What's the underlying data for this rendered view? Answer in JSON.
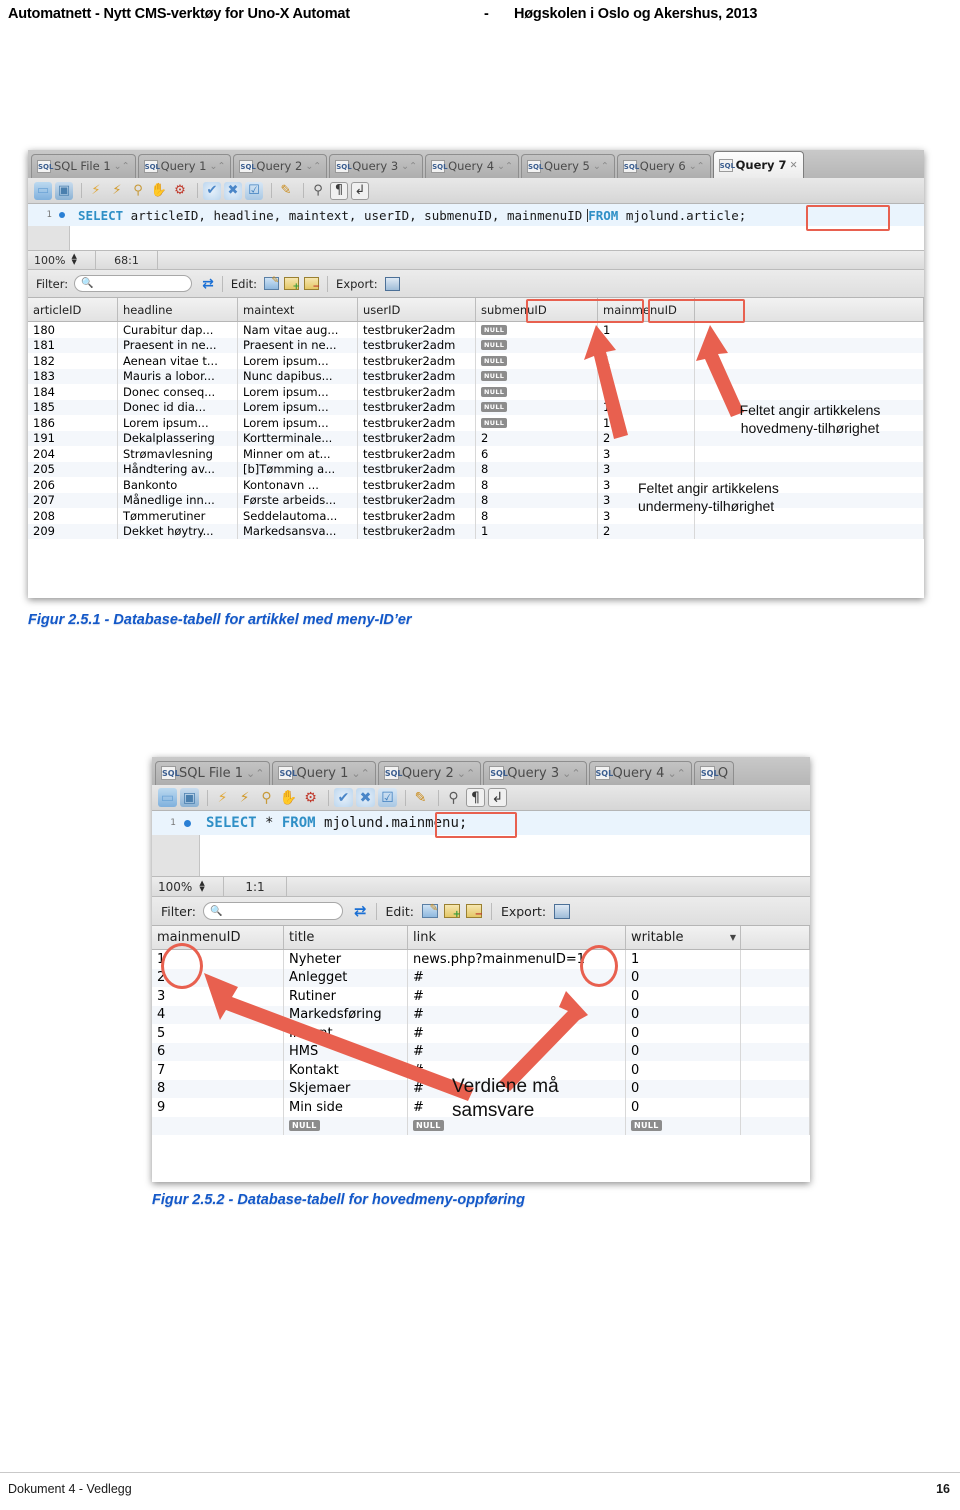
{
  "header": {
    "left": "Automatnett - Nytt CMS-verktøy for Uno-X Automat",
    "dash": "-",
    "right": "Høgskolen i Oslo og Akershus, 2013"
  },
  "footer": {
    "left": "Dokument 4 - Vedlegg",
    "page": "16"
  },
  "figure1": {
    "caption": "Figur 2.5.1 - Database-tabell for artikkel med meny-ID’er",
    "tabs": [
      {
        "label": "SQL File 1",
        "active": false,
        "close": "⌄⌃"
      },
      {
        "label": "Query 1",
        "active": false,
        "close": "⌄⌃"
      },
      {
        "label": "Query 2",
        "active": false,
        "close": "⌄⌃"
      },
      {
        "label": "Query 3",
        "active": false,
        "close": "⌄⌃"
      },
      {
        "label": "Query 4",
        "active": false,
        "close": "⌄⌃"
      },
      {
        "label": "Query 5",
        "active": false,
        "close": "⌄⌃"
      },
      {
        "label": "Query 6",
        "active": false,
        "close": "⌄⌃"
      },
      {
        "label": "Query 7",
        "active": true,
        "close": "✕"
      }
    ],
    "tab_icon_label": "SQL",
    "toolbar_icons": [
      "open-folder-icon",
      "save-disk-icon",
      "execute-lightning-icon",
      "execute-current-lightning-icon",
      "explain-magnifier-icon",
      "stop-hand-icon",
      "toggle-query-icon",
      "commit-check-icon",
      "rollback-cross-icon",
      "autocommit-icon",
      "beautify-brush-icon",
      "find-magnifier-icon",
      "pilcrow-icon",
      "wrap-lines-icon"
    ],
    "sql": {
      "line_number": "1",
      "keyword_select": "SELECT",
      "columns": " articleID, headline, maintext, userID, submenuID, mainmenuID",
      "keyword_from": "FROM",
      "table_prefix": " mjolund",
      "table_boxed": ".article;"
    },
    "status": {
      "zoom": "100%",
      "position": "68:1"
    },
    "filter": {
      "label": "Filter:",
      "value": "",
      "placeholder": ""
    },
    "edit_label": "Edit:",
    "export_label": "Export:",
    "edit_icons": [
      "edit-row-icon",
      "add-row-icon",
      "delete-row-icon"
    ],
    "export_icon": "export-disk-icon",
    "refresh_icon": "refresh-icon",
    "grid": {
      "columns": [
        "articleID",
        "headline",
        "maintext",
        "userID",
        "submenuID",
        "mainmenuID",
        ""
      ],
      "rows": [
        {
          "articleID": "180",
          "headline": "Curabitur dap...",
          "maintext": "Nam vitae aug...",
          "userID": "testbruker2adm",
          "submenuID": "NULL",
          "mainmenuID": "1"
        },
        {
          "articleID": "181",
          "headline": "Praesent in ne...",
          "maintext": "Praesent in ne...",
          "userID": "testbruker2adm",
          "submenuID": "NULL",
          "mainmenuID": "1"
        },
        {
          "articleID": "182",
          "headline": "Aenean vitae t...",
          "maintext": "Lorem ipsum...",
          "userID": "testbruker2adm",
          "submenuID": "NULL",
          "mainmenuID": "1"
        },
        {
          "articleID": "183",
          "headline": "Mauris a lobor...",
          "maintext": "Nunc dapibus...",
          "userID": "testbruker2adm",
          "submenuID": "NULL",
          "mainmenuID": "1"
        },
        {
          "articleID": "184",
          "headline": "Donec conseq...",
          "maintext": "Lorem ipsum...",
          "userID": "testbruker2adm",
          "submenuID": "NULL",
          "mainmenuID": "1"
        },
        {
          "articleID": "185",
          "headline": "Donec id dia...",
          "maintext": "Lorem ipsum...",
          "userID": "testbruker2adm",
          "submenuID": "NULL",
          "mainmenuID": "1"
        },
        {
          "articleID": "186",
          "headline": "Lorem ipsum...",
          "maintext": "Lorem ipsum...",
          "userID": "testbruker2adm",
          "submenuID": "NULL",
          "mainmenuID": "1"
        },
        {
          "articleID": "191",
          "headline": "Dekalplassering",
          "maintext": "Kortterminale...",
          "userID": "testbruker2adm",
          "submenuID": "2",
          "mainmenuID": "2"
        },
        {
          "articleID": "204",
          "headline": "Strømavlesning",
          "maintext": "Minner om at...",
          "userID": "testbruker2adm",
          "submenuID": "6",
          "mainmenuID": "3"
        },
        {
          "articleID": "205",
          "headline": "Håndtering av...",
          "maintext": "[b]Tømming a...",
          "userID": "testbruker2adm",
          "submenuID": "8",
          "mainmenuID": "3"
        },
        {
          "articleID": "206",
          "headline": "Bankonto",
          "maintext": "Kontonavn     ...",
          "userID": "testbruker2adm",
          "submenuID": "8",
          "mainmenuID": "3"
        },
        {
          "articleID": "207",
          "headline": "Månedlige inn...",
          "maintext": "Første arbeids...",
          "userID": "testbruker2adm",
          "submenuID": "8",
          "mainmenuID": "3"
        },
        {
          "articleID": "208",
          "headline": "Tømmerutiner",
          "maintext": "Seddelautoma...",
          "userID": "testbruker2adm",
          "submenuID": "8",
          "mainmenuID": "3"
        },
        {
          "articleID": "209",
          "headline": "Dekket høytry...",
          "maintext": "Markedsansva...",
          "userID": "testbruker2adm",
          "submenuID": "1",
          "mainmenuID": "2"
        }
      ]
    },
    "annotations": [
      {
        "text": "Feltet angir artikkelens\nhovedmeny-tilhørighet"
      },
      {
        "text": "Feltet angir artikkelens\nundermeny-tilhørighet"
      }
    ]
  },
  "figure2": {
    "caption": "Figur 2.5.2 - Database-tabell for hovedmeny-oppføring",
    "tabs": [
      {
        "label": "SQL File 1",
        "active": false,
        "close": "⌄⌃"
      },
      {
        "label": "Query 1",
        "active": false,
        "close": "⌄⌃"
      },
      {
        "label": "Query 2",
        "active": false,
        "close": "⌄⌃"
      },
      {
        "label": "Query 3",
        "active": false,
        "close": "⌄⌃"
      },
      {
        "label": "Query 4",
        "active": false,
        "close": "⌄⌃"
      },
      {
        "label": "Q",
        "active": false,
        "close": ""
      }
    ],
    "tab_icon_label": "SQL",
    "sql": {
      "line_number": "1",
      "keyword_select": "SELECT",
      "star": " * ",
      "keyword_from": "FROM",
      "table_prefix": " mjolund",
      "table_boxed": ".mainmenu;"
    },
    "status": {
      "zoom": "100%",
      "position": "1:1"
    },
    "filter": {
      "label": "Filter:",
      "value": "",
      "placeholder": ""
    },
    "edit_label": "Edit:",
    "export_label": "Export:",
    "grid": {
      "columns": [
        "mainmenuID",
        "title",
        "link",
        "writable",
        ""
      ],
      "sort_indicator": "▼",
      "rows": [
        {
          "mainmenuID": "1",
          "title": "Nyheter",
          "link": "news.php?mainmenuID=1",
          "writable": "1"
        },
        {
          "mainmenuID": "2",
          "title": "Anlegget",
          "link": "#",
          "writable": "0"
        },
        {
          "mainmenuID": "3",
          "title": "Rutiner",
          "link": "#",
          "writable": "0"
        },
        {
          "mainmenuID": "4",
          "title": "Markedsføring",
          "link": "#",
          "writable": "0"
        },
        {
          "mainmenuID": "5",
          "title": "Internt",
          "link": "#",
          "writable": "0"
        },
        {
          "mainmenuID": "6",
          "title": "HMS",
          "link": "#",
          "writable": "0"
        },
        {
          "mainmenuID": "7",
          "title": "Kontakt",
          "link": "#",
          "writable": "0"
        },
        {
          "mainmenuID": "8",
          "title": "Skjemaer",
          "link": "#",
          "writable": "0"
        },
        {
          "mainmenuID": "9",
          "title": "Min side",
          "link": "#",
          "writable": "0"
        },
        {
          "mainmenuID": "",
          "title": "NULL",
          "link": "NULL",
          "writable": "NULL"
        }
      ]
    },
    "annotations": [
      {
        "text": "Verdiene må\nsamsvare"
      }
    ]
  },
  "colors": {
    "annotation_red": "#e8604f",
    "caption_blue": "#1358c8",
    "sql_keyword": "#2f8fc6"
  }
}
